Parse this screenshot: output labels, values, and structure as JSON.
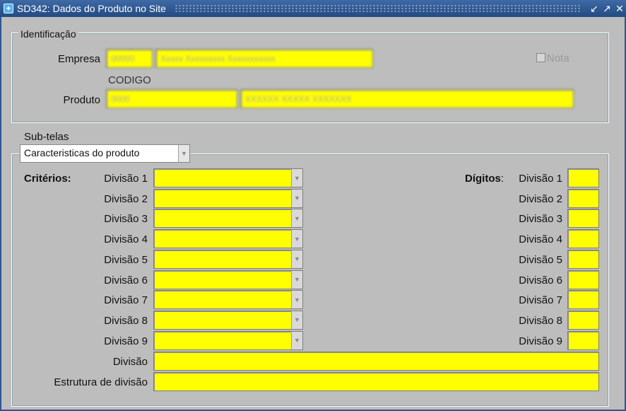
{
  "window": {
    "title": "SD342: Dados do Produto no Site",
    "controls": [
      "↙",
      "↗",
      "✕"
    ]
  },
  "identificacao": {
    "legend": "Identificação",
    "empresa_label": "Empresa",
    "produto_label": "Produto",
    "codigo_header": "CODIGO",
    "nota_label": "Nota",
    "empresa_code": "00000",
    "empresa_name": "Xxxxx Xxxxxxxxx Xxxxxxxxxxx",
    "produto_code": "0000",
    "produto_name": "XXXXXX XXXXX XXXXXXX"
  },
  "subtelas": {
    "label": "Sub-telas",
    "selected": "Caracteristicas do produto"
  },
  "criterios": {
    "label": "Critérios:",
    "digitos_label": "Dígitos",
    "digitos_colon": ":",
    "divisions": [
      "Divisão 1",
      "Divisão 2",
      "Divisão 3",
      "Divisão 4",
      "Divisão 5",
      "Divisão 6",
      "Divisão 7",
      "Divisão 8",
      "Divisão 9"
    ],
    "divisao_label": "Divisão",
    "estrutura_label": "Estrutura de divisão"
  },
  "colors": {
    "field": "#ffff00",
    "titlebar": "#2d5590",
    "background": "#bdbdbd"
  }
}
